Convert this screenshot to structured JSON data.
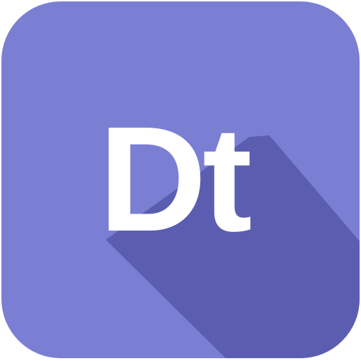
{
  "icon": {
    "text": "Dt",
    "background_color": "#7b7fd3",
    "shadow_color": "#5b5eb0",
    "text_color": "#ffffff"
  }
}
